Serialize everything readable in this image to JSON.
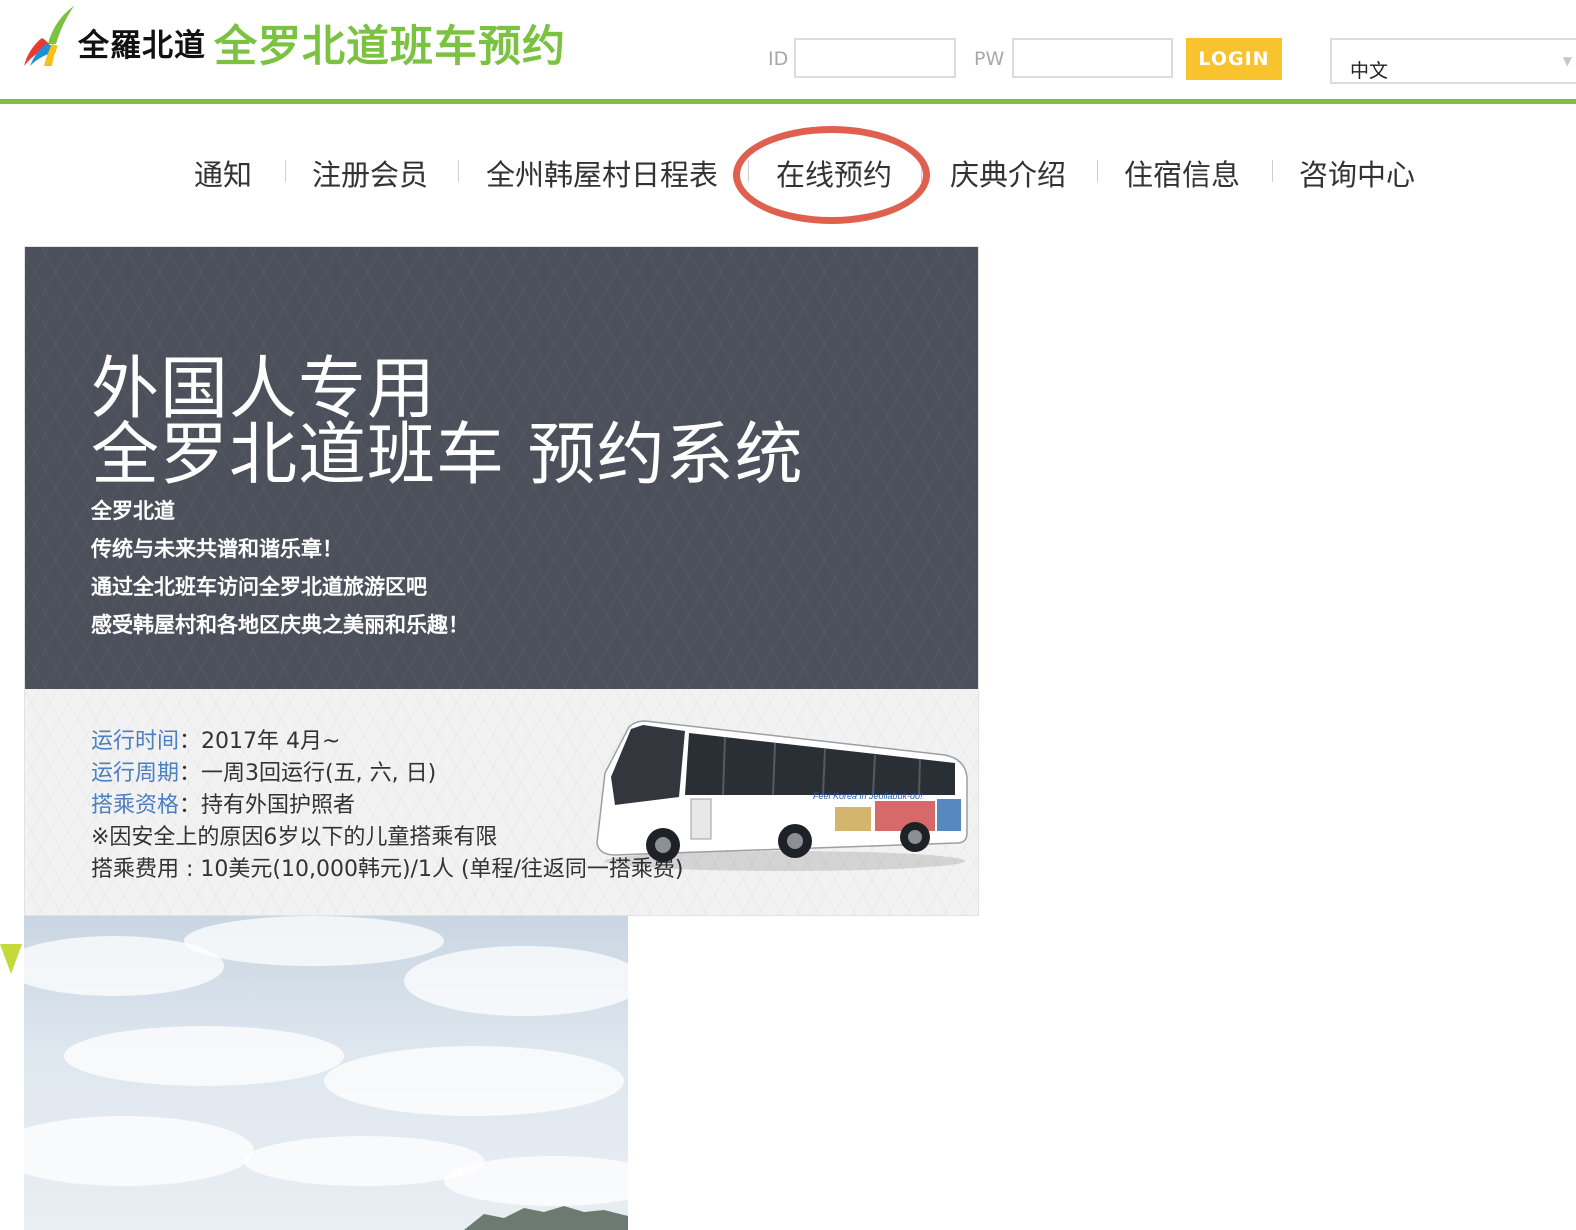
{
  "header": {
    "logo_text": "全羅北道",
    "site_title": "全罗北道班车预约",
    "id_label": "ID",
    "pw_label": "PW",
    "login_button": "LOGIN",
    "language": "中文"
  },
  "nav": {
    "items": [
      "通知",
      "注册会员",
      "全州韩屋村日程表",
      "在线预约",
      "庆典介绍",
      "住宿信息",
      "咨询中心"
    ],
    "highlighted": "在线预约",
    "highlight_color": "#e0604f"
  },
  "banner": {
    "headline_1": "外国人专用",
    "headline_2": "全罗北道班车 预约系统",
    "lines": [
      "全罗北道",
      "传统与未来共谱和谐乐章！",
      "通过全北班车访问全罗北道旅游区吧",
      "感受韩屋村和各地区庆典之美丽和乐趣！"
    ],
    "info": [
      {
        "key": "运行时间",
        "value": "：2017年 4月~"
      },
      {
        "key": "运行周期",
        "value": "：一周3回运行(五, 六, 日)"
      },
      {
        "key": "搭乘资格",
        "value": "：持有外国护照者"
      },
      {
        "key": "",
        "value": "※因安全上的原因6岁以下的儿童搭乘有限"
      },
      {
        "key": "",
        "value": "搭乘费用 : 10美元(10,000韩元)/1人 (单程/往返同一搭乘费)"
      }
    ],
    "bus_slogan": "Feel Korea in Jeollabuk-do!"
  },
  "colors": {
    "brand_green": "#7cc242",
    "login_yellow": "#f9c330",
    "banner_dark": "#4b505b",
    "info_key_blue": "#4a7fc1"
  },
  "icons": {
    "logo": "jeollabuk-do-logo-icon",
    "select_arrow": "chevron-down-icon"
  }
}
